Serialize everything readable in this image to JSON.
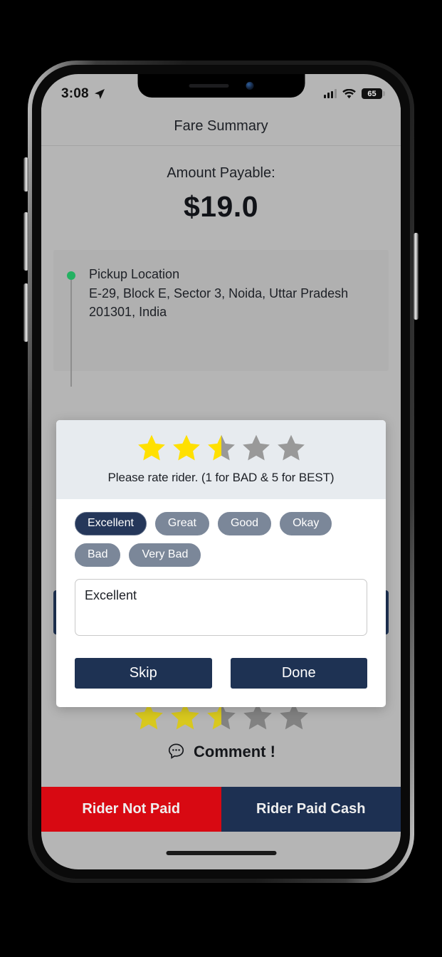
{
  "status_bar": {
    "time": "3:08",
    "location_arrow_icon": "location-arrow-icon",
    "signal_icon": "cellular-signal-icon",
    "wifi_icon": "wifi-icon",
    "battery_level": "65"
  },
  "navbar": {
    "title": "Fare Summary"
  },
  "fare": {
    "amount_label": "Amount Payable:",
    "amount_value": "$19.0"
  },
  "location_card": {
    "pickup_title": "Pickup Location",
    "pickup_address": "E-29, Block E, Sector 3, Noida, Uttar Pradesh 201301, India",
    "pickup_dot_color": "#24b162"
  },
  "rating_behind": {
    "value": 2.5,
    "max": 5,
    "comment_icon": "comment-bubble-icon",
    "comment_label": "Comment !"
  },
  "modal": {
    "rating_value": 2.5,
    "rating_max": 5,
    "prompt": "Please rate rider. (1 for BAD & 5 for BEST)",
    "chips": [
      {
        "label": "Excellent",
        "selected": true
      },
      {
        "label": "Great",
        "selected": false
      },
      {
        "label": "Good",
        "selected": false
      },
      {
        "label": "Okay",
        "selected": false
      },
      {
        "label": "Bad",
        "selected": false
      },
      {
        "label": "Very Bad",
        "selected": false
      }
    ],
    "comment_value": "Excellent",
    "comment_placeholder": "",
    "skip_label": "Skip",
    "done_label": "Done"
  },
  "payment_bar": {
    "not_paid_label": "Rider Not Paid",
    "paid_cash_label": "Rider Paid Cash",
    "not_paid_color": "#d80912",
    "paid_cash_color": "#1d3052"
  },
  "theme": {
    "accent_navy": "#1e3253",
    "chip_gray": "#7b8799",
    "star_gold": "#ffe000",
    "star_gray": "#999999",
    "screen_bg": "#b5b5b5"
  }
}
